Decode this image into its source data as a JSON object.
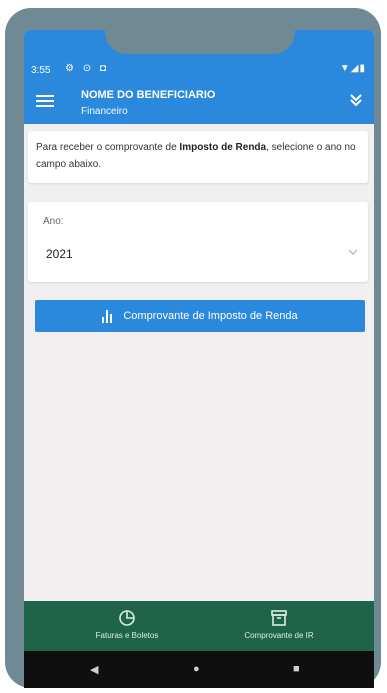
{
  "status": {
    "time": "3:55",
    "left_icons": "⚙ ⊙ ◘",
    "right_icons": "▼◢▮"
  },
  "appbar": {
    "title": "NOME DO BENEFICIARIO",
    "subtitle": "Financeiro",
    "expand_icon": "chevron-double-down-icon"
  },
  "info": {
    "text_before": "Para receber o comprovante de ",
    "text_bold": "Imposto de Renda",
    "text_after": ", selecione o ano no campo abaixo."
  },
  "year_field": {
    "label": "Ano:",
    "value": "2021"
  },
  "primary_button": {
    "label": "Comprovante de Imposto de Renda"
  },
  "bottom_nav": {
    "items": [
      {
        "label": "Faturas e Boletos",
        "icon": "pie-chart-icon"
      },
      {
        "label": "Comprovante de IR",
        "icon": "archive-box-icon"
      }
    ]
  },
  "colors": {
    "primary": "#2a89dc",
    "bottom_nav": "#1f6448",
    "background": "#f1efef",
    "frame": "#6f8a94"
  }
}
